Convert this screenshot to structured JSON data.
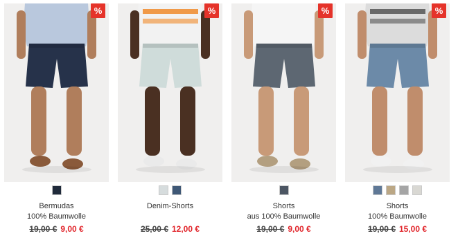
{
  "products": [
    {
      "name": "Bermudas",
      "subtitle": "100% Baumwolle",
      "old_price": "19,00 €",
      "new_price": "9,00 €",
      "badge": "%",
      "swatches": [
        "#1f2a3a"
      ],
      "palette": {
        "top": "#b9c8dd",
        "shorts": "#26324a",
        "skin": "#b07e5c",
        "shoes": "#8a5a3a",
        "topStripe": ""
      }
    },
    {
      "name": "Denim-Shorts",
      "subtitle": "",
      "old_price": "25,00 €",
      "new_price": "12,00 €",
      "badge": "%",
      "swatches": [
        "#d6dcdd",
        "#3f5876"
      ],
      "palette": {
        "top": "#f2f2f2",
        "shorts": "#cfdcda",
        "skin": "#4a3022",
        "shoes": "#eaeaea",
        "topStripe": "#f08a2a"
      }
    },
    {
      "name": "Shorts",
      "subtitle": "aus 100% Baumwolle",
      "old_price": "19,00 €",
      "new_price": "9,00 €",
      "badge": "%",
      "swatches": [
        "#4c5663"
      ],
      "palette": {
        "top": "#f5f5f5",
        "shorts": "#5d6772",
        "skin": "#c89a78",
        "shoes": "#b39f80",
        "topStripe": ""
      }
    },
    {
      "name": "Shorts",
      "subtitle": "100% Baumwolle",
      "old_price": "19,00 €",
      "new_price": "15,00 €",
      "badge": "%",
      "swatches": [
        "#5f7896",
        "#bba785",
        "#a5a5a5",
        "#d9d8d3"
      ],
      "palette": {
        "top": "#dcdcdc",
        "shorts": "#6c8aa8",
        "skin": "#c08d6c",
        "shoes": "#f1f1f1",
        "topStripe": "#555555"
      }
    }
  ]
}
